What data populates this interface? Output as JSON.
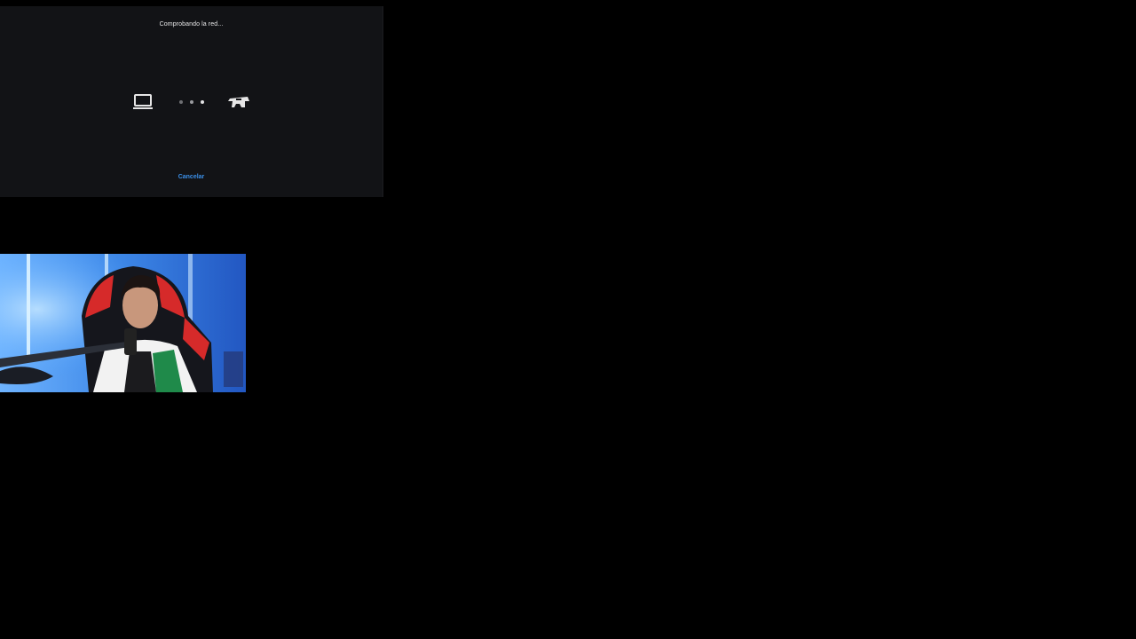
{
  "dialog": {
    "title": "Comprobando la red...",
    "cancel_label": "Cancelar",
    "left_device_icon": "laptop-icon",
    "right_device_icon": "console-icon",
    "progress_icon": "connection-dots-icon"
  },
  "webcam": {
    "icon": "webcam-feed-image"
  },
  "colors": {
    "background": "#000000",
    "dialog_bg": "#121316",
    "title_text": "#e9e9ea",
    "link": "#3b8fe8",
    "icon": "#e6e6e6",
    "dot_dim": "#6e6f73",
    "dot_mid": "#9a9b9f",
    "dot_bright": "#e2e2e4"
  }
}
